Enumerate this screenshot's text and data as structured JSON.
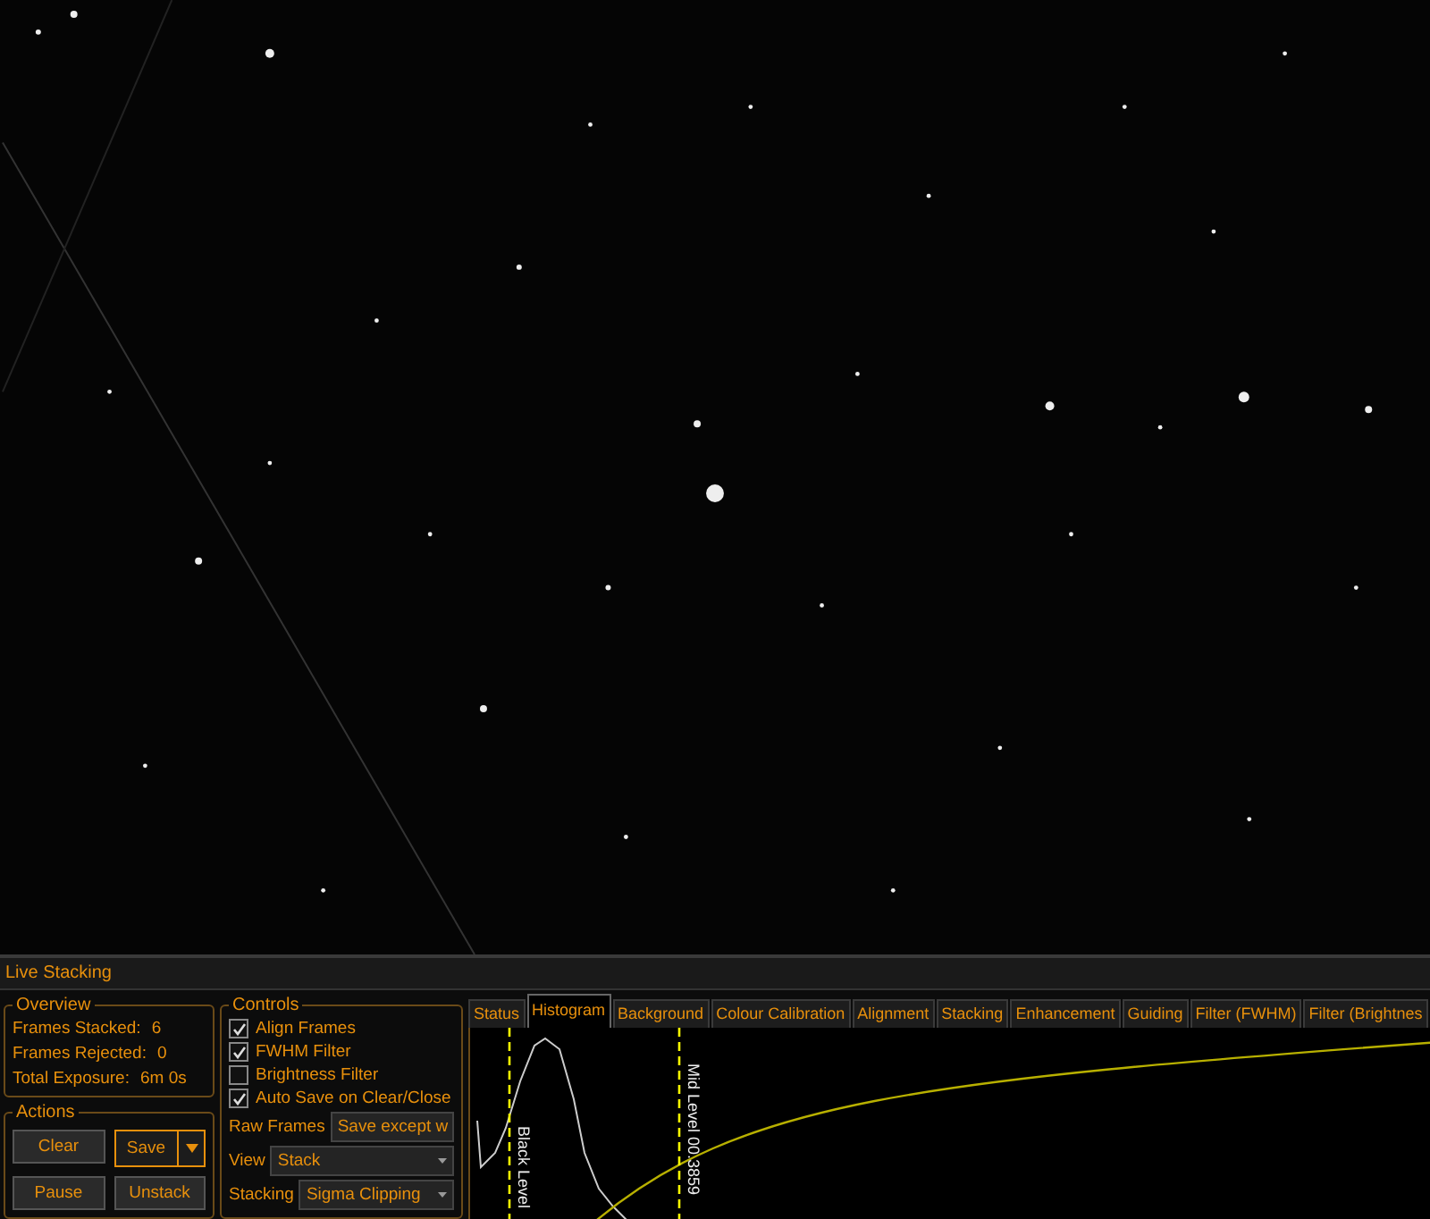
{
  "panel": {
    "title": "Live Stacking"
  },
  "overview": {
    "title": "Overview",
    "stats": [
      {
        "label": "Frames Stacked:",
        "value": "6"
      },
      {
        "label": "Frames Rejected:",
        "value": "0"
      },
      {
        "label": "Total Exposure:",
        "value": "6m 0s"
      }
    ]
  },
  "actions": {
    "title": "Actions",
    "buttons": [
      {
        "label": "Clear",
        "kind": "plain"
      },
      {
        "label": "Save",
        "kind": "split"
      },
      {
        "label": "Pause",
        "kind": "plain"
      },
      {
        "label": "Unstack",
        "kind": "plain"
      }
    ]
  },
  "controls": {
    "title": "Controls",
    "checkboxes": [
      {
        "label": "Align Frames",
        "checked": true
      },
      {
        "label": "FWHM Filter",
        "checked": true
      },
      {
        "label": "Brightness Filter",
        "checked": false
      },
      {
        "label": "Auto Save on Clear/Close",
        "checked": true
      }
    ],
    "dropdowns": [
      {
        "label": "Raw Frames",
        "value": "Save except w"
      },
      {
        "label": "View",
        "value": "Stack"
      },
      {
        "label": "Stacking",
        "value": "Sigma Clipping"
      }
    ]
  },
  "tabs": [
    {
      "label": "Status",
      "selected": false
    },
    {
      "label": "Histogram",
      "selected": true
    },
    {
      "label": "Background",
      "selected": false
    },
    {
      "label": "Colour Calibration",
      "selected": false
    },
    {
      "label": "Alignment",
      "selected": false
    },
    {
      "label": "Stacking",
      "selected": false
    },
    {
      "label": "Enhancement",
      "selected": false
    },
    {
      "label": "Guiding",
      "selected": false
    },
    {
      "label": "Filter (FWHM)",
      "selected": false
    },
    {
      "label": "Filter (Brightnes",
      "selected": false
    }
  ],
  "histogram": {
    "markers": [
      {
        "label": "Black Level"
      },
      {
        "label": "Mid Level  00.3859"
      }
    ]
  }
}
